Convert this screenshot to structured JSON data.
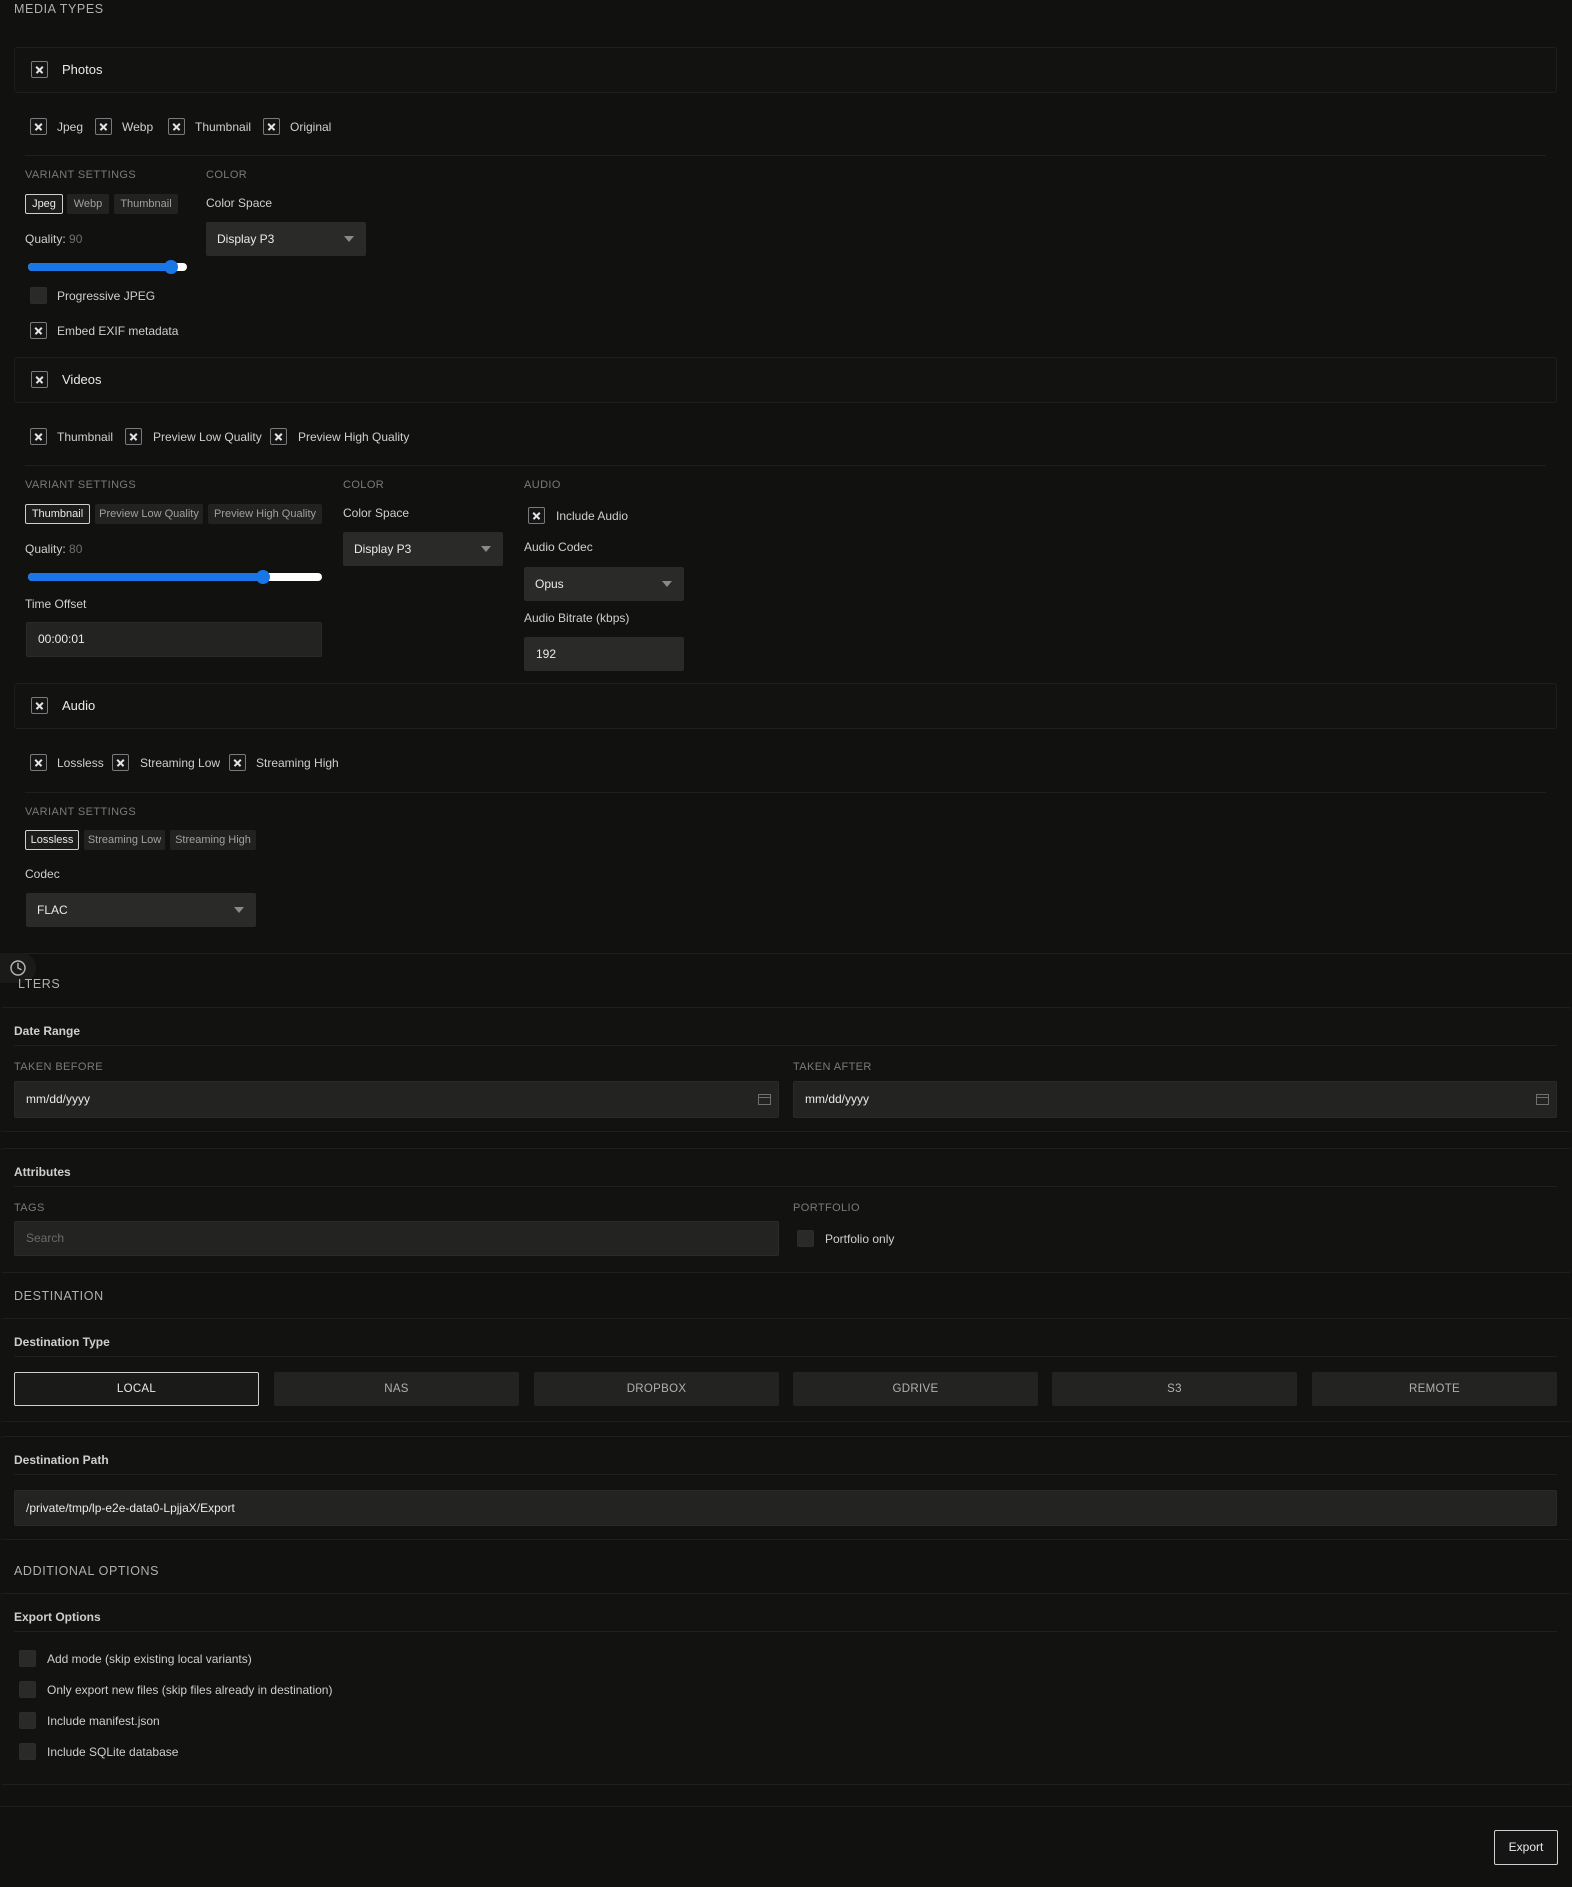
{
  "media_types": {
    "title": "MEDIA TYPES",
    "photos": {
      "label": "Photos",
      "variants": [
        "Jpeg",
        "Webp",
        "Thumbnail",
        "Original"
      ],
      "variant_settings_title": "VARIANT SETTINGS",
      "tabs": [
        "Jpeg",
        "Webp",
        "Thumbnail"
      ],
      "active_tab": "Jpeg",
      "quality_label": "Quality:",
      "quality_value": "90",
      "quality_fraction": 0.9,
      "progressive_label": "Progressive JPEG",
      "embed_exif_label": "Embed EXIF metadata",
      "color_title": "COLOR",
      "color_space_label": "Color Space",
      "color_space_value": "Display P3"
    },
    "videos": {
      "label": "Videos",
      "variants": [
        "Thumbnail",
        "Preview Low Quality",
        "Preview High Quality"
      ],
      "variant_settings_title": "VARIANT SETTINGS",
      "tabs": [
        "Thumbnail",
        "Preview Low Quality",
        "Preview High Quality"
      ],
      "active_tab": "Thumbnail",
      "quality_label": "Quality:",
      "quality_value": "80",
      "quality_fraction": 0.8,
      "time_offset_label": "Time Offset",
      "time_offset_value": "00:00:01",
      "color_title": "COLOR",
      "color_space_label": "Color Space",
      "color_space_value": "Display P3",
      "audio_title": "AUDIO",
      "include_audio_label": "Include Audio",
      "audio_codec_label": "Audio Codec",
      "audio_codec_value": "Opus",
      "audio_bitrate_label": "Audio Bitrate (kbps)",
      "audio_bitrate_value": "192"
    },
    "audio": {
      "label": "Audio",
      "variants": [
        "Lossless",
        "Streaming Low",
        "Streaming High"
      ],
      "variant_settings_title": "VARIANT SETTINGS",
      "tabs": [
        "Lossless",
        "Streaming Low",
        "Streaming High"
      ],
      "active_tab": "Lossless",
      "codec_label": "Codec",
      "codec_value": "FLAC"
    }
  },
  "filters": {
    "title_visible": "LTERS",
    "date_range_title": "Date Range",
    "taken_before_label": "TAKEN BEFORE",
    "taken_before_placeholder": "mm/dd/yyyy",
    "taken_after_label": "TAKEN AFTER",
    "taken_after_placeholder": "mm/dd/yyyy",
    "attributes_title": "Attributes",
    "tags_label": "TAGS",
    "tags_placeholder": "Search",
    "portfolio_label": "PORTFOLIO",
    "portfolio_only_label": "Portfolio only"
  },
  "destination": {
    "title": "DESTINATION",
    "type_title": "Destination Type",
    "types": [
      "LOCAL",
      "NAS",
      "DROPBOX",
      "GDRIVE",
      "S3",
      "REMOTE"
    ],
    "active_type": "LOCAL",
    "path_title": "Destination Path",
    "path_value": "/private/tmp/lp-e2e-data0-LpjjaX/Export"
  },
  "additional_options": {
    "title": "ADDITIONAL OPTIONS",
    "export_options_title": "Export Options",
    "options": [
      "Add mode (skip existing local variants)",
      "Only export new files (skip files already in destination)",
      "Include manifest.json",
      "Include SQLite database"
    ]
  },
  "footer": {
    "export_label": "Export"
  }
}
